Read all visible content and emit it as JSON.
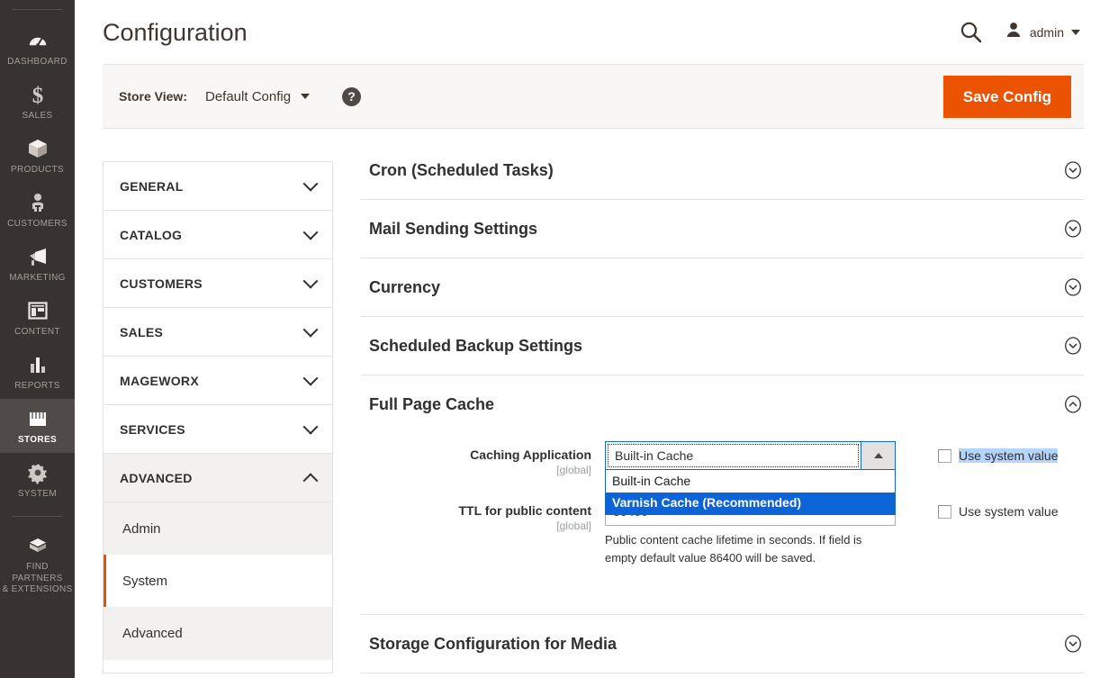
{
  "colors": {
    "brand_orange": "#eb5202",
    "rail_bg": "#373330",
    "rail_active_bg": "#4f4b48",
    "focus_blue": "#1469b8",
    "option_selected_blue": "#0c64d8",
    "selection_highlight": "#b4d5fe",
    "text_dark": "#303030",
    "scope_grey": "#9ba0a3"
  },
  "header": {
    "title": "Configuration",
    "search_icon": "search-icon",
    "user_icon": "user-avatar-icon",
    "username": "admin",
    "user_caret_icon": "chevron-down-icon"
  },
  "store_view_bar": {
    "label": "Store View:",
    "selected": "Default Config",
    "caret_icon": "chevron-down-icon",
    "help_icon": "question-mark-icon",
    "help_text": "?",
    "save_label": "Save Config"
  },
  "rail": {
    "items": [
      {
        "label": "Dashboard",
        "icon": "dashboard-gauge-icon",
        "active": false
      },
      {
        "label": "Sales",
        "icon": "dollar-sign-icon",
        "active": false
      },
      {
        "label": "Products",
        "icon": "box-icon",
        "active": false
      },
      {
        "label": "Customers",
        "icon": "person-icon",
        "active": false
      },
      {
        "label": "Marketing",
        "icon": "megaphone-icon",
        "active": false
      },
      {
        "label": "Content",
        "icon": "layout-panels-icon",
        "active": false
      },
      {
        "label": "Reports",
        "icon": "bar-chart-icon",
        "active": false
      },
      {
        "label": "Stores",
        "icon": "storefront-icon",
        "active": true
      },
      {
        "label": "System",
        "icon": "gear-icon",
        "active": false
      },
      {
        "label": "Find Partners\n& Extensions",
        "icon": "plugin-block-icon",
        "active": false
      }
    ]
  },
  "config_nav": {
    "sections": [
      {
        "label": "General",
        "open": false
      },
      {
        "label": "Catalog",
        "open": false
      },
      {
        "label": "Customers",
        "open": false
      },
      {
        "label": "Sales",
        "open": false
      },
      {
        "label": "Mageworx",
        "open": false
      },
      {
        "label": "Services",
        "open": false
      },
      {
        "label": "Advanced",
        "open": true
      }
    ],
    "advanced_children": [
      {
        "label": "Admin",
        "active": false
      },
      {
        "label": "System",
        "active": true
      },
      {
        "label": "Advanced",
        "active": false
      }
    ]
  },
  "groups": [
    {
      "title": "Cron (Scheduled Tasks)",
      "expanded": false
    },
    {
      "title": "Mail Sending Settings",
      "expanded": false
    },
    {
      "title": "Currency",
      "expanded": false
    },
    {
      "title": "Scheduled Backup Settings",
      "expanded": false
    },
    {
      "title": "Full Page Cache",
      "expanded": true
    },
    {
      "title": "Storage Configuration for Media",
      "expanded": false
    }
  ],
  "full_page_cache": {
    "caching_application": {
      "label": "Caching Application",
      "scope": "[global]",
      "value": "Built-in Cache",
      "dropdown_open": true,
      "options": [
        {
          "label": "Built-in Cache",
          "selected": false
        },
        {
          "label": "Varnish Cache (Recommended)",
          "selected": true
        }
      ],
      "use_system_value_label": "Use system value",
      "use_system_value_checked": false,
      "label_text_highlighted": true
    },
    "ttl_public_content": {
      "label": "TTL for public content",
      "scope": "[global]",
      "value": "86400",
      "note": "Public content cache lifetime in seconds. If field is empty default value 86400 will be saved.",
      "use_system_value_label": "Use system value",
      "use_system_value_checked": false
    }
  }
}
